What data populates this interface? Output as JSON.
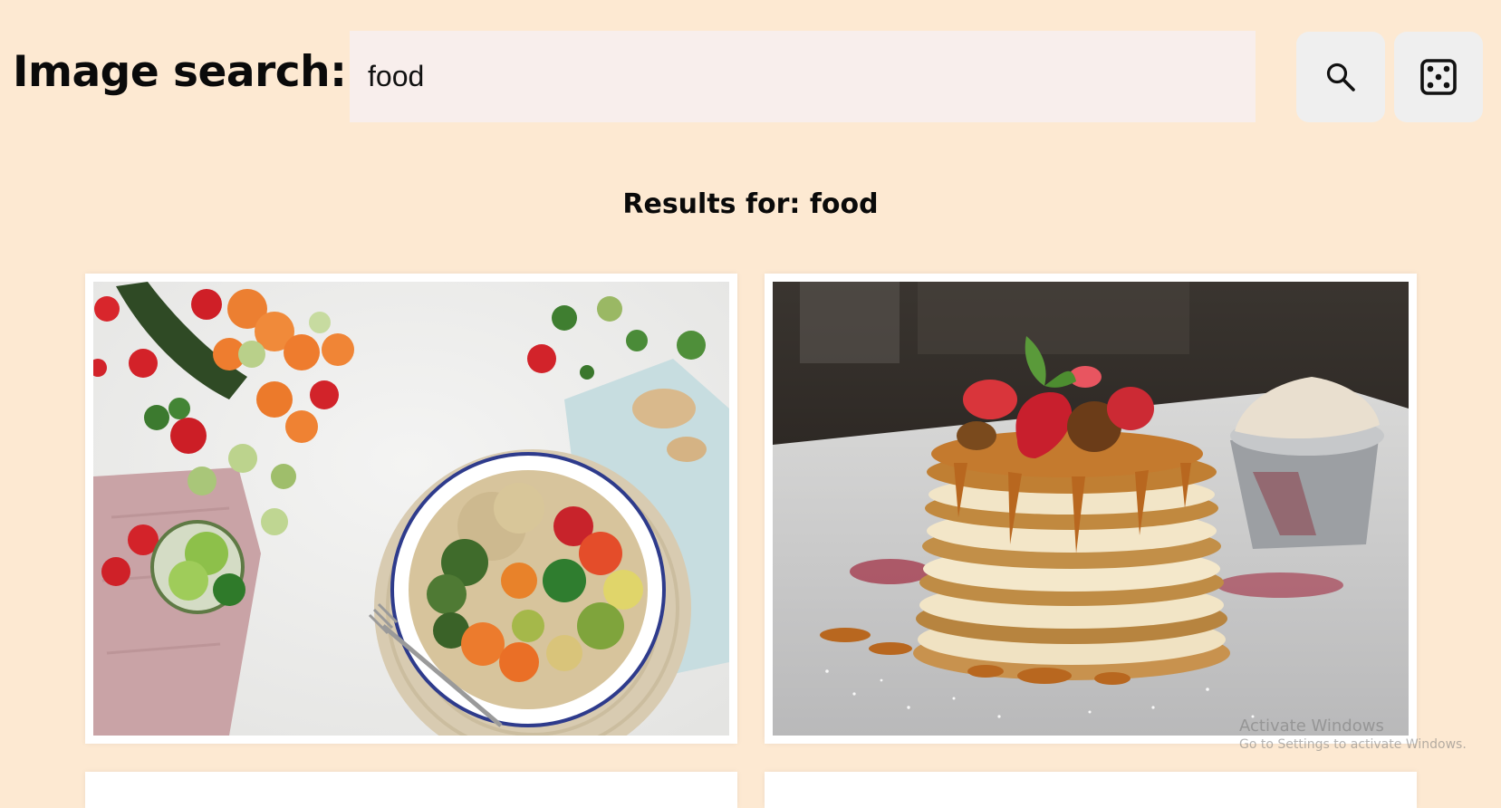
{
  "header": {
    "title": "Image search:",
    "search_value": "food",
    "search_button_icon": "search-icon",
    "random_button_icon": "dice-icon"
  },
  "results": {
    "heading": "Results for: food",
    "images": [
      {
        "icon": "vegetable-bowl-photo"
      },
      {
        "icon": "pancake-stack-photo"
      }
    ]
  },
  "os_watermark": {
    "line1": "Activate Windows",
    "line2": "Go to Settings to activate Windows."
  },
  "colors": {
    "background": "#fde9d2",
    "search_field": "#f8eeec",
    "button": "#efefef",
    "card": "#ffffff"
  }
}
